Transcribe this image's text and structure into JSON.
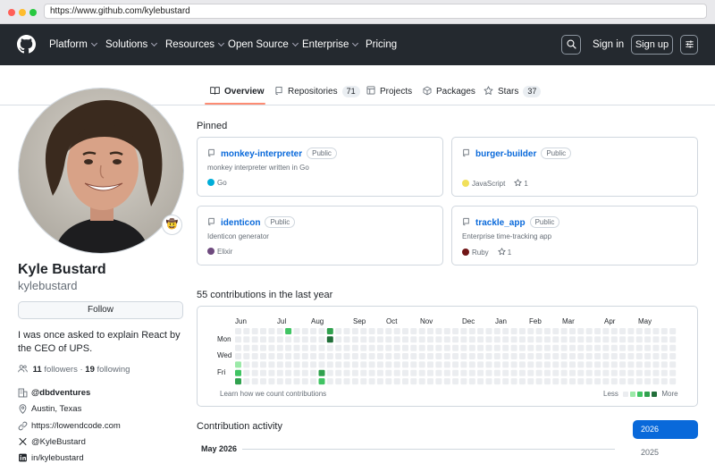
{
  "browser": {
    "url": "https://www.github.com/kylebustard"
  },
  "header": {
    "nav": [
      {
        "label": "Platform",
        "dropdown": true
      },
      {
        "label": "Solutions",
        "dropdown": true
      },
      {
        "label": "Resources",
        "dropdown": true
      },
      {
        "label": "Open Source",
        "dropdown": true
      },
      {
        "label": "Enterprise",
        "dropdown": true
      },
      {
        "label": "Pricing",
        "dropdown": false
      }
    ],
    "sign_in": "Sign in",
    "sign_up": "Sign up",
    "icons": [
      "github-logo-icon",
      "search-icon",
      "menu-sliders-icon"
    ]
  },
  "tabs": [
    {
      "label": "Overview",
      "icon": "book-icon",
      "selected": true
    },
    {
      "label": "Repositories",
      "count": "71",
      "icon": "repo-icon"
    },
    {
      "label": "Projects",
      "icon": "table-icon"
    },
    {
      "label": "Packages",
      "icon": "package-icon"
    },
    {
      "label": "Stars",
      "count": "37",
      "icon": "star-icon"
    }
  ],
  "profile": {
    "name": "Kyle Bustard",
    "login": "kylebustard",
    "follow_label": "Follow",
    "bio": "I was once asked to explain React by the CEO of UPS.",
    "followers_count": "11",
    "followers_label": "followers",
    "separator": "·",
    "following_count": "19",
    "following_label": "following",
    "status_emoji": "🤠",
    "details": [
      {
        "icon": "organization-icon",
        "text": "@dbdventures",
        "bold": true
      },
      {
        "icon": "location-icon",
        "text": "Austin, Texas"
      },
      {
        "icon": "link-icon",
        "text": "https://lowendcode.com"
      },
      {
        "icon": "x-logo-icon",
        "text": "@KyleBustard"
      },
      {
        "icon": "linkedin-icon",
        "text": "in/kylebustard"
      }
    ]
  },
  "pinned": {
    "title": "Pinned",
    "public_label": "Public",
    "repos": [
      {
        "name": "monkey-interpreter",
        "description": "monkey interpreter written in Go",
        "language": "Go",
        "lang_color": "#00add8",
        "stars": ""
      },
      {
        "name": "burger-builder",
        "description": "",
        "language": "JavaScript",
        "lang_color": "#f1e05a",
        "stars": "1"
      },
      {
        "name": "identicon",
        "description": "Identicon generator",
        "language": "Elixir",
        "lang_color": "#6e4a7e",
        "stars": ""
      },
      {
        "name": "trackle_app",
        "description": "Enterprise time-tracking app",
        "language": "Ruby",
        "lang_color": "#701516",
        "stars": "1"
      }
    ]
  },
  "contributions": {
    "title": "55 contributions in the last year",
    "months": [
      "Jun",
      "Jul",
      "Aug",
      "Sep",
      "Oct",
      "Nov",
      "Dec",
      "Jan",
      "Feb",
      "Mar",
      "Apr",
      "May"
    ],
    "day_labels": [
      "Mon",
      "Wed",
      "Fri"
    ],
    "learn_link": "Learn how we count contributions",
    "legend_less": "Less",
    "legend_more": "More",
    "colors": [
      "#ebedf0",
      "#9be9a8",
      "#40c463",
      "#30a14e",
      "#216e39"
    ],
    "weeks": 53,
    "active_cells": [
      {
        "week": 0,
        "day": 4,
        "level": 1
      },
      {
        "week": 0,
        "day": 5,
        "level": 2
      },
      {
        "week": 0,
        "day": 6,
        "level": 3
      },
      {
        "week": 6,
        "day": 0,
        "level": 2
      },
      {
        "week": 10,
        "day": 5,
        "level": 3
      },
      {
        "week": 10,
        "day": 6,
        "level": 2
      },
      {
        "week": 11,
        "day": 0,
        "level": 3
      },
      {
        "week": 11,
        "day": 1,
        "level": 4
      }
    ]
  },
  "activity": {
    "title": "Contribution activity",
    "years": [
      "2026",
      "2025"
    ],
    "selected_year": "2026",
    "month_heading": "May 2026"
  }
}
